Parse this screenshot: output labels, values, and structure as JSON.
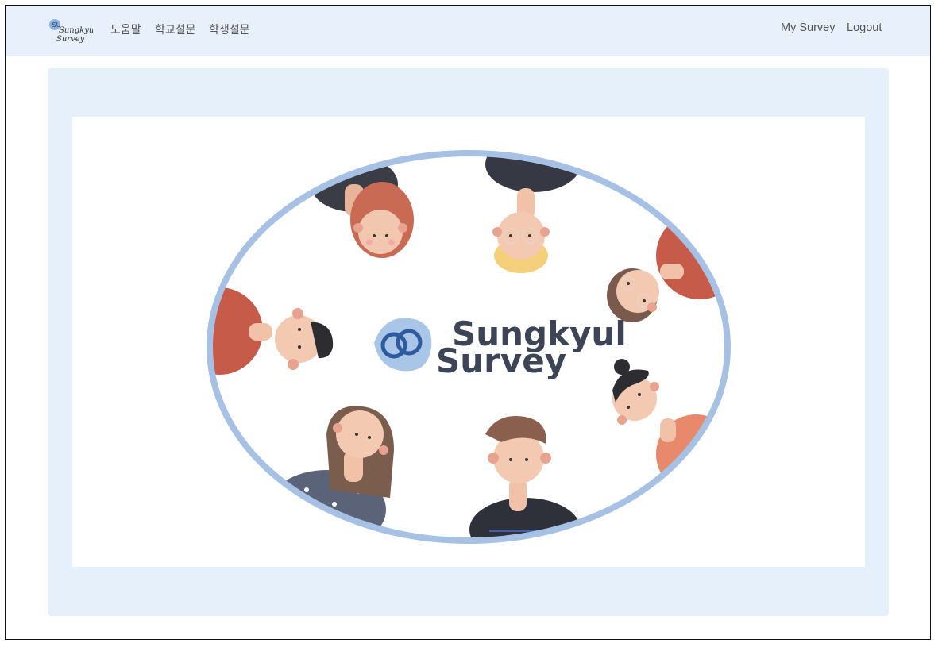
{
  "navbar": {
    "logo": {
      "line1": "Sungkyul",
      "line2": "Survey",
      "mark": "SU"
    },
    "links": [
      {
        "label": "도움말"
      },
      {
        "label": "학교설문"
      },
      {
        "label": "학생설문"
      }
    ],
    "right_links": [
      {
        "label": "My Survey"
      },
      {
        "label": "Logout"
      }
    ]
  },
  "hero": {
    "brand_line1": "Sungkyul",
    "brand_line2": "Survey",
    "colors": {
      "ring": "#a6c1e3",
      "brand_text": "#3d4456",
      "logo_blob": "#a9c5e8",
      "logo_rings": "#2e5a9e"
    }
  }
}
